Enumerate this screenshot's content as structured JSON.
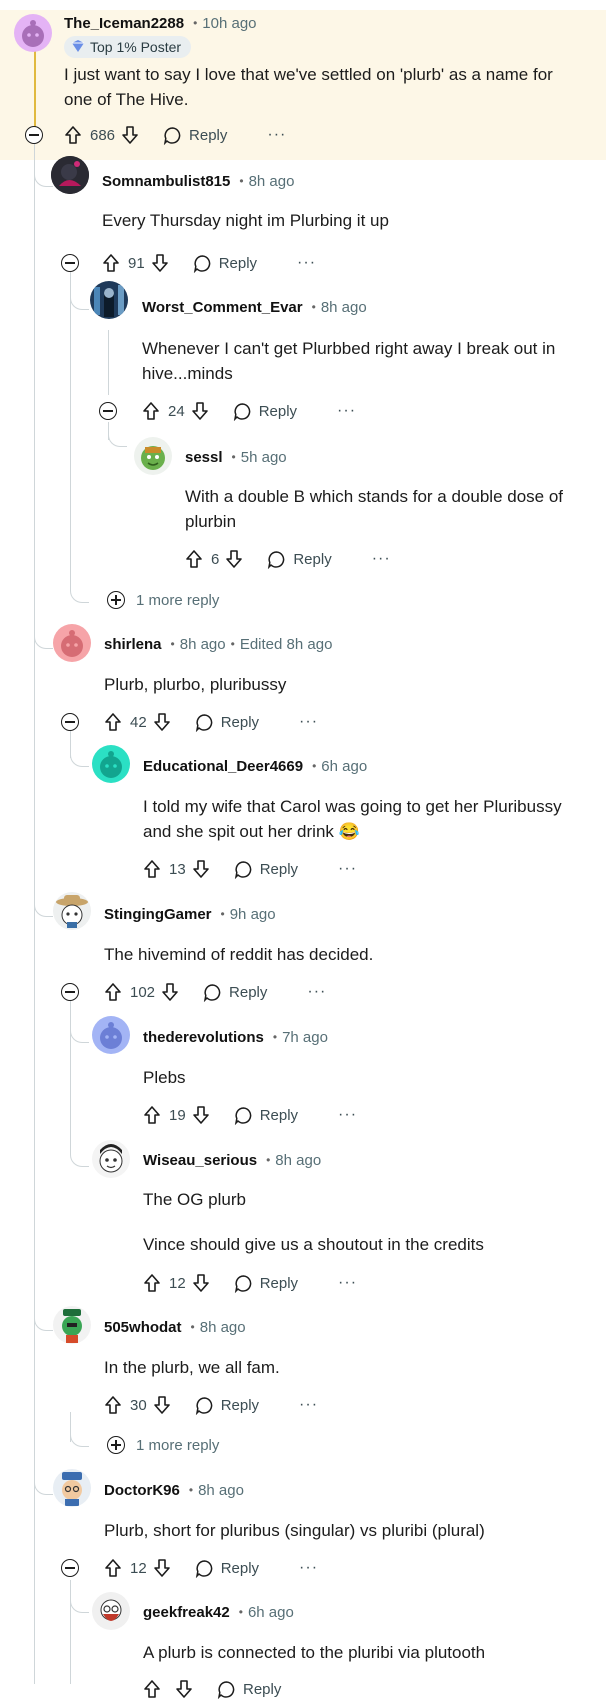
{
  "labels": {
    "reply": "Reply",
    "more": "···"
  },
  "colors": {
    "highlight": "#fdf7e7",
    "thread_line": "#cfd6d9",
    "text": "#1c1c1c",
    "meta": "#576f76"
  },
  "comments": [
    {
      "user": "The_Iceman2288",
      "time": "10h ago",
      "badge": "Top 1% Poster",
      "body": [
        "I just want to say I love that we've settled on 'plurb' as a name for one of The Hive."
      ],
      "votes": "686",
      "avatar": "snoo-pink"
    },
    {
      "user": "Somnambulist815",
      "time": "8h ago",
      "body": [
        "Every Thursday night im Plurbing it up"
      ],
      "votes": "91",
      "avatar": "photo-dark"
    },
    {
      "user": "Worst_Comment_Evar",
      "time": "8h ago",
      "body": [
        "Whenever I can't get Plurbbed right away I break out in hive...minds"
      ],
      "votes": "24",
      "avatar": "photo-blue"
    },
    {
      "user": "sessl",
      "time": "5h ago",
      "body": [
        "With a double B which stands for a double dose of plurbin"
      ],
      "votes": "6",
      "avatar": "snoo-green"
    },
    {
      "user": "shirlena",
      "time": "8h ago",
      "edited": "Edited 8h ago",
      "body": [
        "Plurb, plurbo, pluribussy"
      ],
      "votes": "42",
      "avatar": "snoo-coral"
    },
    {
      "user": "Educational_Deer4669",
      "time": "6h ago",
      "body": [
        "I told my wife that Carol was going to get her Pluribussy and she spit out her drink 😂"
      ],
      "votes": "13",
      "avatar": "snoo-teal"
    },
    {
      "user": "StingingGamer",
      "time": "9h ago",
      "body": [
        "The hivemind of reddit has decided."
      ],
      "votes": "102",
      "avatar": "snoo-hat"
    },
    {
      "user": "thederevolutions",
      "time": "7h ago",
      "body": [
        "Plebs"
      ],
      "votes": "19",
      "avatar": "snoo-periwinkle"
    },
    {
      "user": "Wiseau_serious",
      "time": "8h ago",
      "body": [
        "The OG plurb",
        "Vince should give us a shoutout in the credits"
      ],
      "votes": "12",
      "avatar": "snoo-white"
    },
    {
      "user": "505whodat",
      "time": "8h ago",
      "body": [
        "In the plurb, we all fam."
      ],
      "votes": "30",
      "avatar": "snoo-green-hat"
    },
    {
      "user": "DoctorK96",
      "time": "8h ago",
      "body": [
        "Plurb, short for pluribus (singular) vs pluribi (plural)"
      ],
      "votes": "12",
      "avatar": "snoo-cap"
    },
    {
      "user": "geekfreak42",
      "time": "6h ago",
      "body": [
        "A plurb is connected to the pluribi via plutooth"
      ],
      "votes": "",
      "avatar": "snoo-beard"
    }
  ],
  "more_replies": [
    "1 more reply",
    "1 more reply"
  ]
}
